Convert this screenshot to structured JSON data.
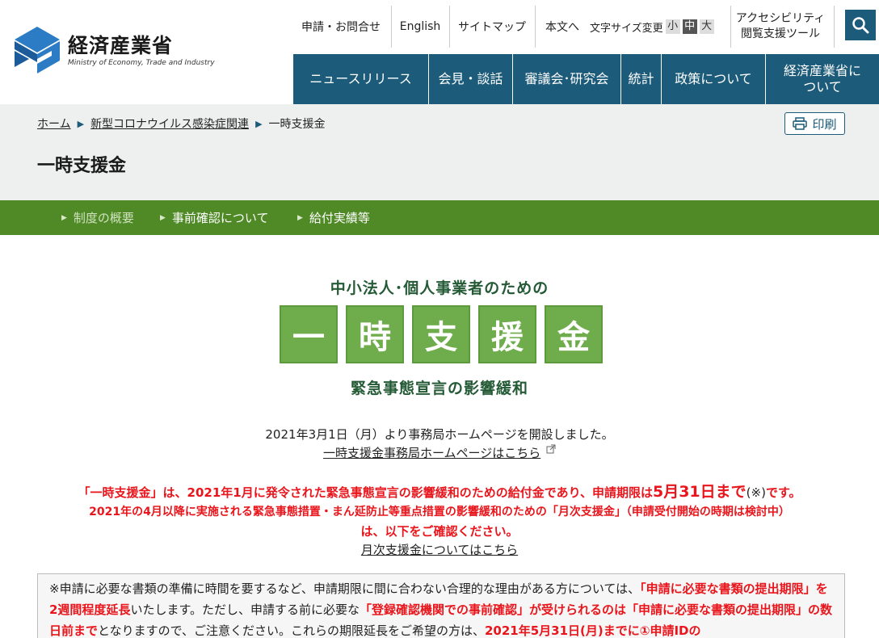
{
  "logo": {
    "name": "経済産業省",
    "subtitle": "Ministry of Economy, Trade and Industry"
  },
  "utility_nav": {
    "contact": "申請・お問合せ",
    "english": "English",
    "sitemap": "サイトマップ",
    "skip_to_content": "本文へ",
    "font_size_label": "文字サイズ変更",
    "font_small": "小",
    "font_medium": "中",
    "font_large": "大",
    "accessibility": "アクセシビリティ閲覧支援ツール"
  },
  "main_nav": [
    {
      "label": "ニュースリリース"
    },
    {
      "label": "会見・談話"
    },
    {
      "label": "審議会･研究会"
    },
    {
      "label": "統計"
    },
    {
      "label": "政策について"
    },
    {
      "label": "経済産業省について"
    }
  ],
  "breadcrumb": {
    "home": "ホーム",
    "parent": "新型コロナウイルス感染症関連",
    "current": "一時支援金"
  },
  "print_label": "印刷",
  "page_title": "一時支援金",
  "sub_nav": [
    {
      "label": "制度の概要"
    },
    {
      "label": "事前確認について"
    },
    {
      "label": "給付実績等"
    }
  ],
  "hero": {
    "lead": "中小法人･個人事業者のための",
    "chars": [
      "一",
      "時",
      "支",
      "援",
      "金"
    ],
    "sub": "緊急事態宣言の影響緩和"
  },
  "notice": {
    "opened": "2021年3月1日（月）より事務局ホームページを開設しました。",
    "office_link": "一時支援金事務局ホームページはこちら",
    "red1_a": "「一時支援金」は、2021年1月に発令された緊急事態宣言の影響緩和のための給付金であり、申請期限は",
    "red1_deadline": "5月31日まで",
    "red1_mark": "(※)",
    "red1_end": "です。",
    "red2": "2021年の4月以降に実施される緊急事態措置・まん延防止等重点措置の影響緩和のための「月次支援金」（申請受付開始の時期は検討中）",
    "red3": "は、以下をご確認ください。",
    "monthly_link": "月次支援金についてはこちら"
  },
  "note": {
    "p1": "※申請に必要な書類の準備に時間を要するなど、申請期限に間に合わない合理的な理由がある方については、",
    "r1": "「申請に必要な書類の提出期限」を2週間程度延長",
    "p2": "いたします。ただし、申請する前に必要な",
    "r2": "「登録確認機関での事前確認」が受けられるのは「申請に必要な書類の提出期限」の数日前まで",
    "p3": "となりますので、ご注意ください。これらの期限延長をご希望の方は、",
    "r3": "2021年5月31日(月)までに①申請IDの"
  },
  "colors": {
    "nav_blue": "#1c5b79",
    "sub_green": "#4f8a26",
    "hero_green": "#6fac4c",
    "hero_text": "#245b36",
    "alert_red": "#e8161c"
  }
}
